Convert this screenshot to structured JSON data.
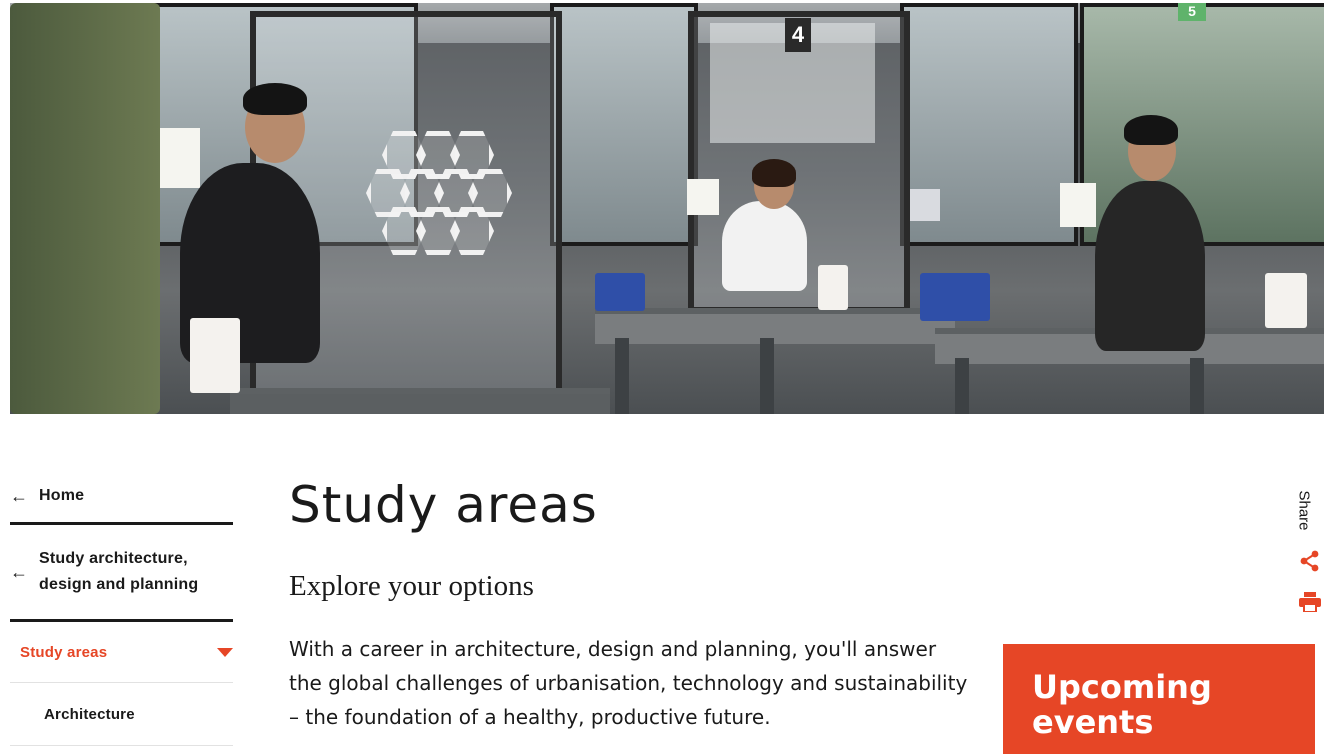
{
  "hero": {
    "sign_number": "4",
    "sign_number_2": "5"
  },
  "sidenav": {
    "home": {
      "label": "Home",
      "icon": "arrow-left-icon"
    },
    "parent": {
      "label_line1": "Study architecture,",
      "label_line2": "design and planning",
      "icon": "arrow-left-icon"
    },
    "current": {
      "label": "Study areas",
      "icon": "caret-down-icon"
    },
    "children": [
      {
        "label": "Architecture"
      }
    ]
  },
  "main": {
    "title": "Study areas",
    "subtitle": "Explore your options",
    "intro": "With a career in architecture, design and planning, you'll answer the global challenges of urbanisation, technology and sustainability – the foundation of a healthy, productive future."
  },
  "events": {
    "title_line1": "Upcoming",
    "title_line2": "events"
  },
  "share": {
    "label": "Share",
    "share_icon": "share-icon",
    "print_icon": "print-icon"
  },
  "colors": {
    "accent": "#e64626",
    "text": "#1a1a1a",
    "divider": "#e2e2e2"
  }
}
